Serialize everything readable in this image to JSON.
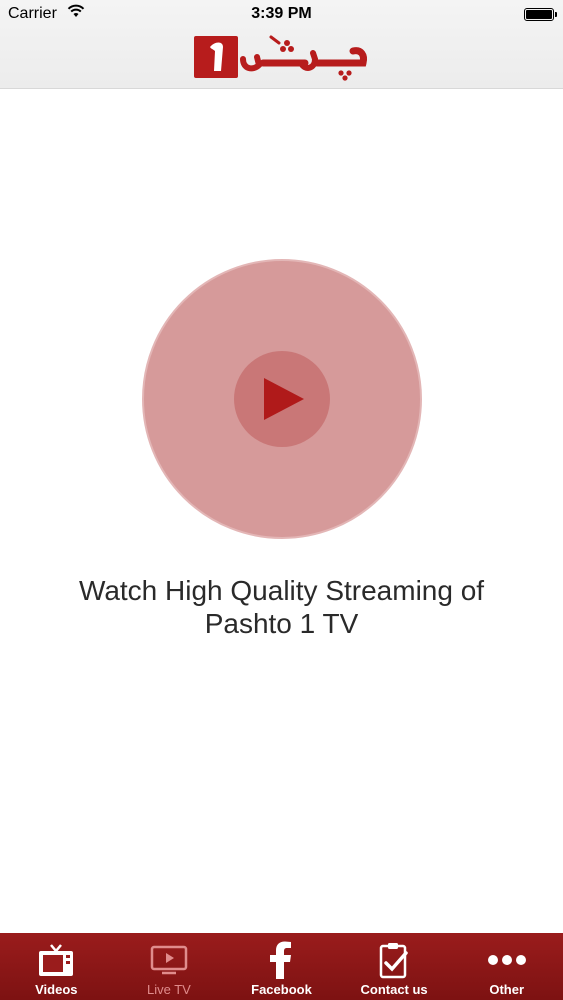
{
  "status_bar": {
    "carrier": "Carrier",
    "time": "3:39 PM"
  },
  "header": {
    "logo_alt": "پشتو ۱"
  },
  "main": {
    "caption": "Watch High Quality Streaming  of\nPashto 1 TV",
    "play_icon": "play-icon"
  },
  "tabbar": {
    "items": [
      {
        "label": "Videos",
        "icon": "tv-icon",
        "active": false
      },
      {
        "label": "Live TV",
        "icon": "live-tv-icon",
        "active": true
      },
      {
        "label": "Facebook",
        "icon": "facebook-icon",
        "active": false
      },
      {
        "label": "Contact us",
        "icon": "clipboard-check-icon",
        "active": false
      },
      {
        "label": "Other",
        "icon": "more-dots-icon",
        "active": false
      }
    ]
  },
  "colors": {
    "brand_red": "#8b1515",
    "circle_outer": "#d69a9a",
    "circle_inner": "#c97777",
    "play": "#b01a1a",
    "active_tab": "#e08c8c"
  }
}
